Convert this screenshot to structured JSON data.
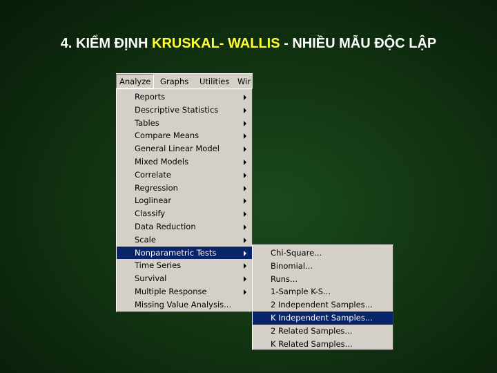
{
  "slide": {
    "title_prefix": "4. KIỂM ĐỊNH ",
    "title_highlight": "KRUSKAL- WALLIS",
    "title_suffix": " - NHIỀU MẪU ĐỘC LẬP",
    "colors": {
      "title": "#ffffff",
      "highlight": "#ffff33",
      "background": "#123512"
    }
  },
  "menubar": {
    "items": [
      {
        "label": "Analyze",
        "active": true
      },
      {
        "label": "Graphs"
      },
      {
        "label": "Utilities"
      },
      {
        "label": "Wir"
      }
    ]
  },
  "analyze_menu": {
    "items": [
      {
        "label": "Reports",
        "submenu": true
      },
      {
        "label": "Descriptive Statistics",
        "submenu": true
      },
      {
        "label": "Tables",
        "submenu": true
      },
      {
        "label": "Compare Means",
        "submenu": true
      },
      {
        "label": "General Linear Model",
        "submenu": true
      },
      {
        "label": "Mixed Models",
        "submenu": true
      },
      {
        "label": "Correlate",
        "submenu": true
      },
      {
        "label": "Regression",
        "submenu": true
      },
      {
        "label": "Loglinear",
        "submenu": true
      },
      {
        "label": "Classify",
        "submenu": true
      },
      {
        "label": "Data Reduction",
        "submenu": true
      },
      {
        "label": "Scale",
        "submenu": true
      },
      {
        "label": "Nonparametric Tests",
        "submenu": true,
        "selected": true
      },
      {
        "label": "Time Series",
        "submenu": true
      },
      {
        "label": "Survival",
        "submenu": true
      },
      {
        "label": "Multiple Response",
        "submenu": true
      },
      {
        "label": "Missing Value Analysis...",
        "submenu": false
      }
    ]
  },
  "nonparametric_submenu": {
    "items": [
      {
        "label": "Chi-Square..."
      },
      {
        "label": "Binomial..."
      },
      {
        "label": "Runs..."
      },
      {
        "label": "1-Sample K-S..."
      },
      {
        "label": "2 Independent Samples..."
      },
      {
        "label": "K Independent Samples...",
        "selected": true
      },
      {
        "label": "2 Related Samples..."
      },
      {
        "label": "K Related Samples..."
      }
    ]
  },
  "selection_color": "#0a246a",
  "menu_bg_color": "#d4d0c8"
}
